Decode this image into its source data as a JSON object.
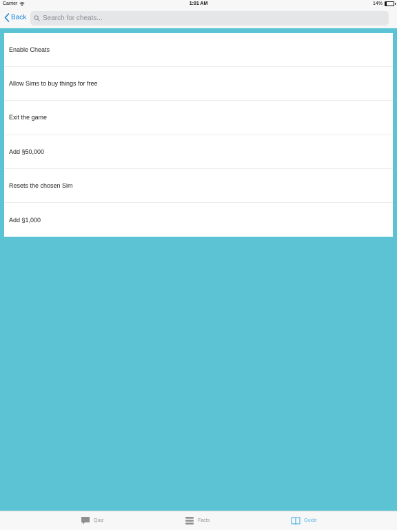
{
  "status_bar": {
    "carrier": "Carrier",
    "time": "1:01 AM",
    "battery_percent": "14%",
    "battery_level": 0.14
  },
  "nav": {
    "back_label": "Back",
    "search_placeholder": "Search for cheats..."
  },
  "list": {
    "items": [
      {
        "label": "Enable Cheats"
      },
      {
        "label": "Allow Sims to buy things for free"
      },
      {
        "label": "Exit the game"
      },
      {
        "label": "Add §50,000"
      },
      {
        "label": "Resets the chosen Sim"
      },
      {
        "label": "Add §1,000"
      }
    ]
  },
  "tabs": [
    {
      "label": "Quiz",
      "icon": "speech-bubble-icon",
      "selected": false
    },
    {
      "label": "Facts",
      "icon": "list-icon",
      "selected": false
    },
    {
      "label": "Guide",
      "icon": "book-icon",
      "selected": true
    }
  ],
  "colors": {
    "background": "#5bc3d3",
    "accent": "#1a84d9",
    "tab_selected": "#5ab9e3",
    "tab_unselected": "#8e8e93"
  }
}
